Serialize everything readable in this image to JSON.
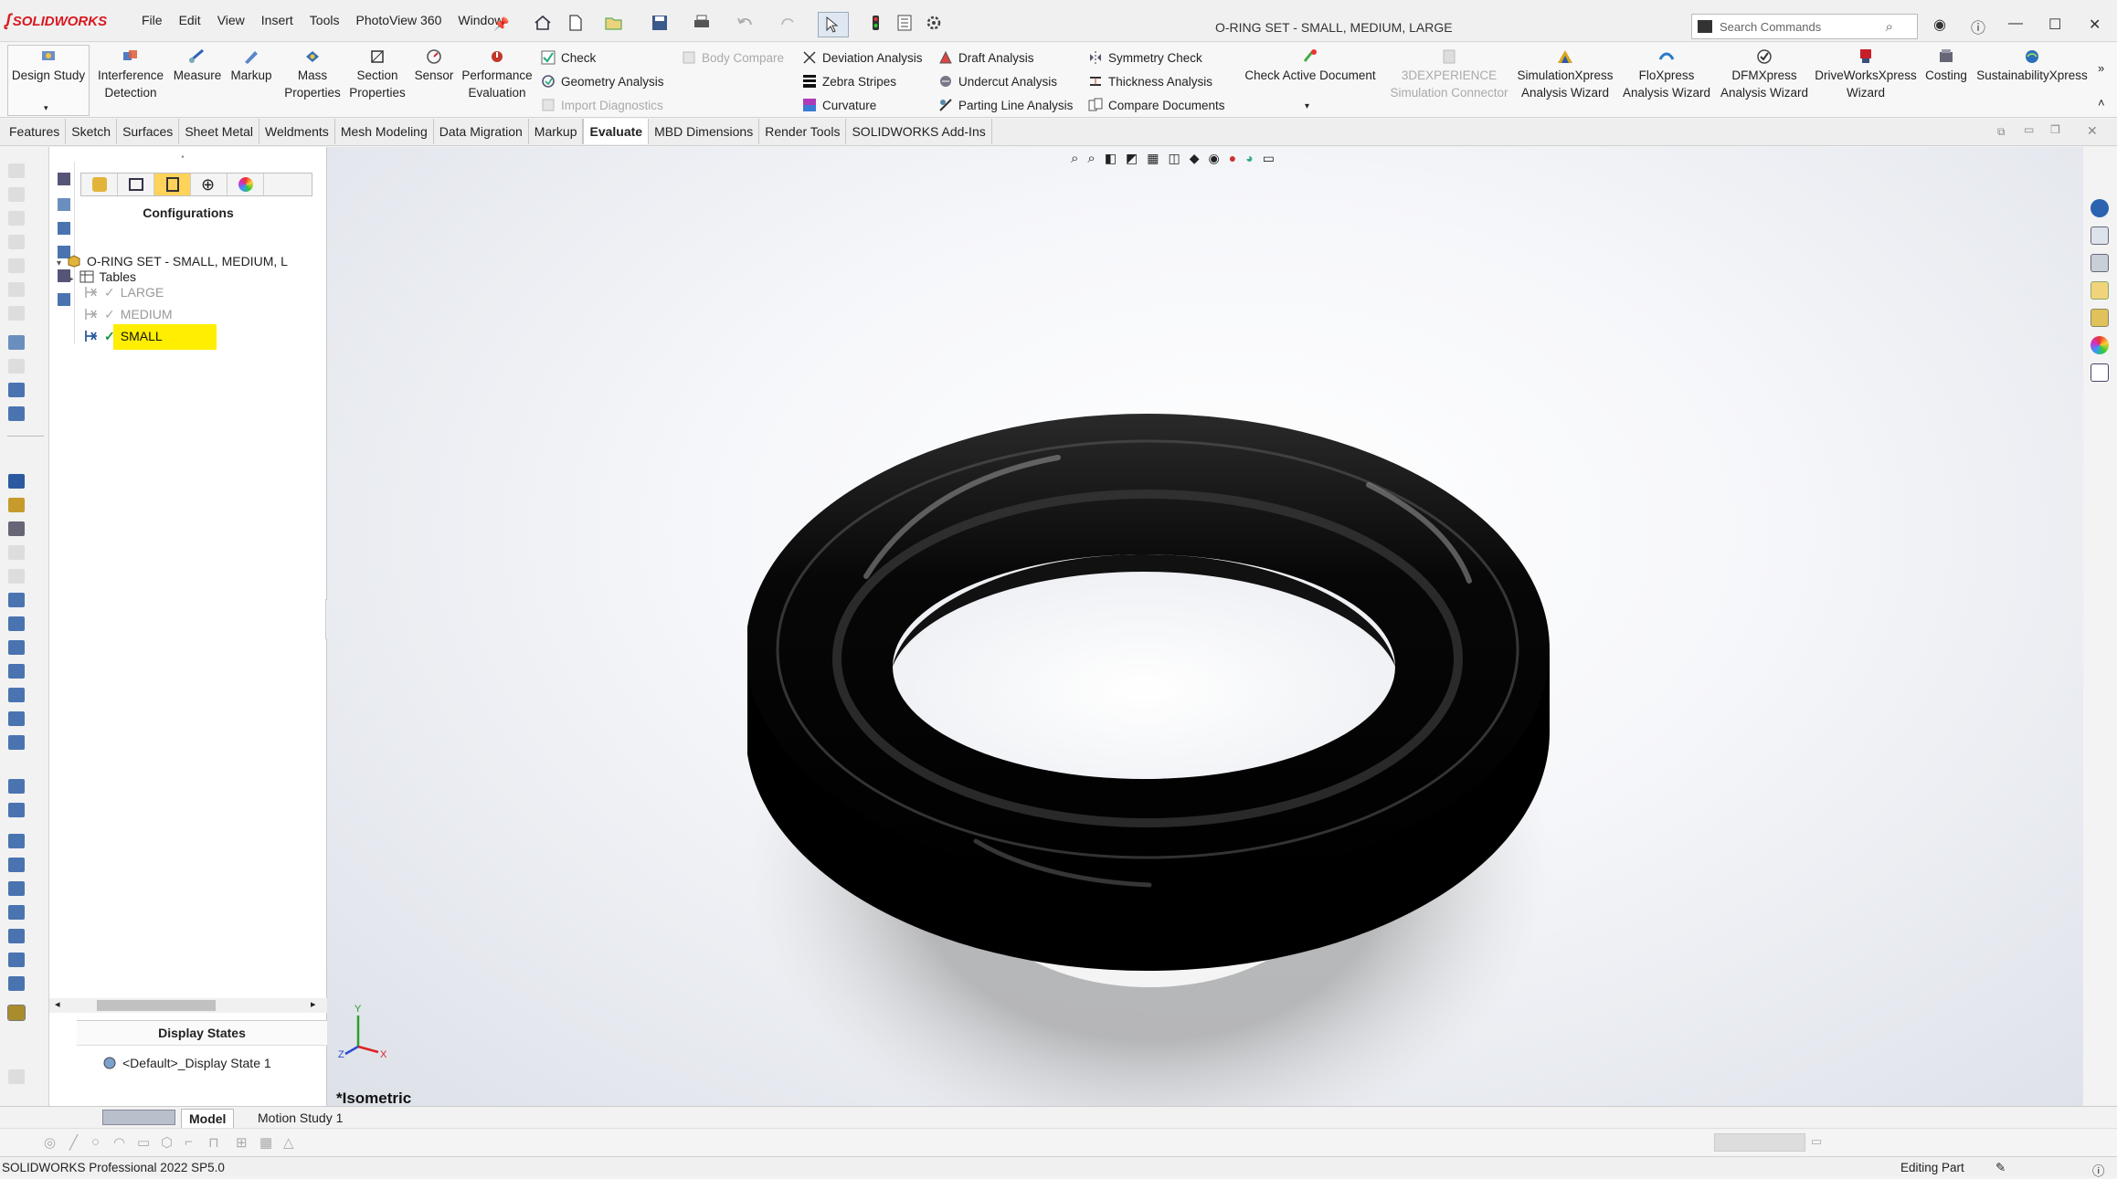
{
  "app": {
    "logo": "SOLIDWORKS",
    "menus": [
      "File",
      "Edit",
      "View",
      "Insert",
      "Tools",
      "PhotoView 360",
      "Window"
    ],
    "document_title": "O-RING SET - SMALL, MEDIUM, LARGE",
    "search_placeholder": "Search Commands"
  },
  "ribbon": {
    "buttons": [
      {
        "label1": "Design Study",
        "label2": "",
        "icon": "design-study-icon"
      },
      {
        "label1": "Interference",
        "label2": "Detection",
        "icon": "interference-icon"
      },
      {
        "label1": "Measure",
        "label2": "",
        "icon": "measure-icon"
      },
      {
        "label1": "Markup",
        "label2": "",
        "icon": "markup-icon"
      },
      {
        "label1": "Mass",
        "label2": "Properties",
        "icon": "mass-properties-icon"
      },
      {
        "label1": "Section",
        "label2": "Properties",
        "icon": "section-properties-icon"
      },
      {
        "label1": "Sensor",
        "label2": "",
        "icon": "sensor-icon"
      },
      {
        "label1": "Performance",
        "label2": "Evaluation",
        "icon": "performance-icon"
      }
    ],
    "check_group": {
      "check": "Check",
      "geometry": "Geometry Analysis",
      "import": "Import Diagnostics",
      "body_compare": "Body Compare"
    },
    "analysis_col1": [
      "Deviation Analysis",
      "Zebra Stripes",
      "Curvature"
    ],
    "analysis_col2": [
      "Draft Analysis",
      "Undercut Analysis",
      "Parting Line Analysis"
    ],
    "analysis_col3": [
      "Symmetry Check",
      "Thickness Analysis",
      "Compare Documents"
    ],
    "check_active": "Check Active Document",
    "xpress_buttons": [
      {
        "label1": "3DEXPERIENCE",
        "label2": "Simulation Connector",
        "disabled": true
      },
      {
        "label1": "SimulationXpress",
        "label2": "Analysis Wizard",
        "disabled": false
      },
      {
        "label1": "FloXpress",
        "label2": "Analysis Wizard",
        "disabled": false
      },
      {
        "label1": "DFMXpress",
        "label2": "Analysis Wizard",
        "disabled": false
      },
      {
        "label1": "DriveWorksXpress",
        "label2": "Wizard",
        "disabled": false
      },
      {
        "label1": "Costing",
        "label2": "",
        "disabled": false
      },
      {
        "label1": "SustainabilityXpress",
        "label2": "",
        "disabled": false
      }
    ]
  },
  "tabs": [
    "Features",
    "Sketch",
    "Surfaces",
    "Sheet Metal",
    "Weldments",
    "Mesh Modeling",
    "Data Migration",
    "Markup",
    "Evaluate",
    "MBD Dimensions",
    "Render Tools",
    "SOLIDWORKS Add-Ins"
  ],
  "active_tab": "Evaluate",
  "config_manager": {
    "title": "Configurations",
    "root": "O-RING SET - SMALL, MEDIUM, L",
    "tables": "Tables",
    "configs": [
      "LARGE",
      "MEDIUM",
      "SMALL"
    ],
    "active_config": "SMALL",
    "display_states_title": "Display States",
    "display_state": "<Default>_Display State 1"
  },
  "viewport": {
    "view_label": "*Isometric",
    "model_color": "#0a0a0a"
  },
  "bottom_tabs": [
    "Model",
    "Motion Study 1"
  ],
  "status": {
    "left": "SOLIDWORKS Professional 2022 SP5.0",
    "right": "Editing Part"
  },
  "colors": {
    "highlight": "#ffee00",
    "brand": "#d8191f"
  }
}
